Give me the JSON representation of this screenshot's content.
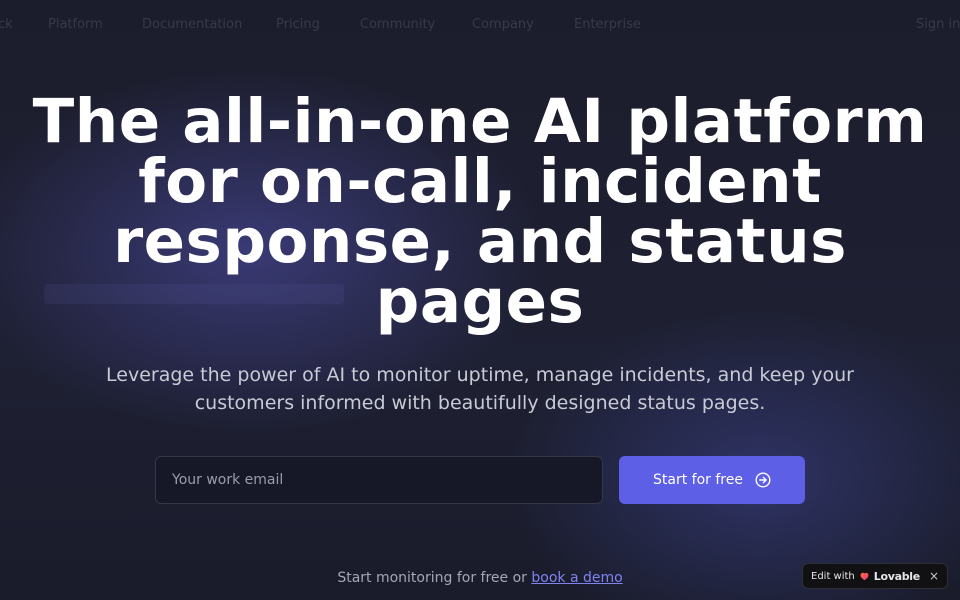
{
  "colors": {
    "background": "#1a1c2b",
    "accent": "#5d5fe6",
    "link": "#8082f0"
  },
  "nav": {
    "brand_fragment": "ck",
    "items": [
      "Platform",
      "Documentation",
      "Pricing",
      "Community",
      "Company",
      "Enterprise"
    ],
    "right": "Sign in"
  },
  "hero": {
    "title": "The all-in-one AI platform for on-call, incident response, and status pages",
    "subtitle": "Leverage the power of AI to monitor uptime, manage incidents, and keep your customers informed with beautifully designed status pages."
  },
  "signup": {
    "email_placeholder": "Your work email",
    "cta_label": "Start for free",
    "cta_icon": "arrow-right-circle-icon"
  },
  "footnote": {
    "text": "Start monitoring for free or ",
    "link_label": "book a demo"
  },
  "badge": {
    "prefix": "Edit with",
    "brand": "Lovable",
    "close": "×"
  }
}
